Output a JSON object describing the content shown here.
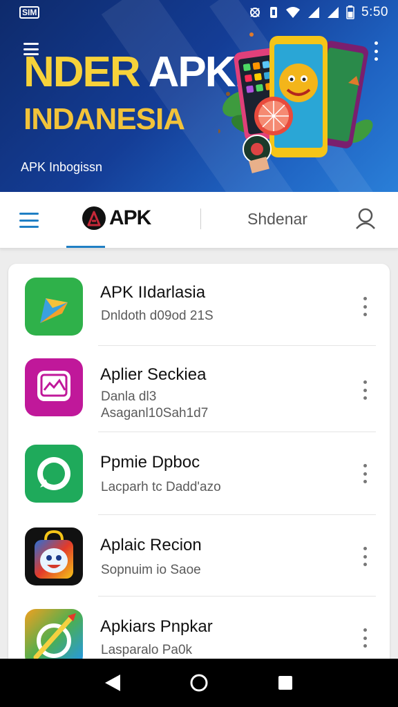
{
  "status_bar": {
    "sim_label": "SIM",
    "time": "5:50"
  },
  "banner": {
    "title_part1": "NDER",
    "title_part2": " APKK",
    "subtitle": "INDANESIA",
    "tagline": "APK Inbogissn"
  },
  "navbar": {
    "logo_text": "APK",
    "search_label": "Shdenar"
  },
  "apps": [
    {
      "title": "APK IIdarlasia",
      "line1": "Dnldoth d09od 21S",
      "line2": "",
      "icon": "play-arrow-icon",
      "color": "#2fb14a"
    },
    {
      "title": "Aplier Seckiea",
      "line1": "Danla dl3",
      "line2": "Asaganl10Sah1d7",
      "icon": "chat-bubble-icon",
      "color": "#c0189a"
    },
    {
      "title": "Ppmie Dpboc",
      "line1": "Lacparh tc Dadd'azo",
      "line2": "",
      "icon": "phone-chat-icon",
      "color": "#1faa5b"
    },
    {
      "title": "Aplaic Recion",
      "line1": "Sopnuim io Saoe",
      "line2": "",
      "icon": "shopping-bag-face-icon",
      "color": "#e23a2a"
    },
    {
      "title": "Apkiars Pnpkar",
      "line1": "Lasparalo Pa0k",
      "line2": "",
      "icon": "paint-brush-icon",
      "color": "#f0a020"
    }
  ],
  "colors": {
    "accent": "#1f7fc4",
    "banner_yellow": "#f7d23a"
  }
}
